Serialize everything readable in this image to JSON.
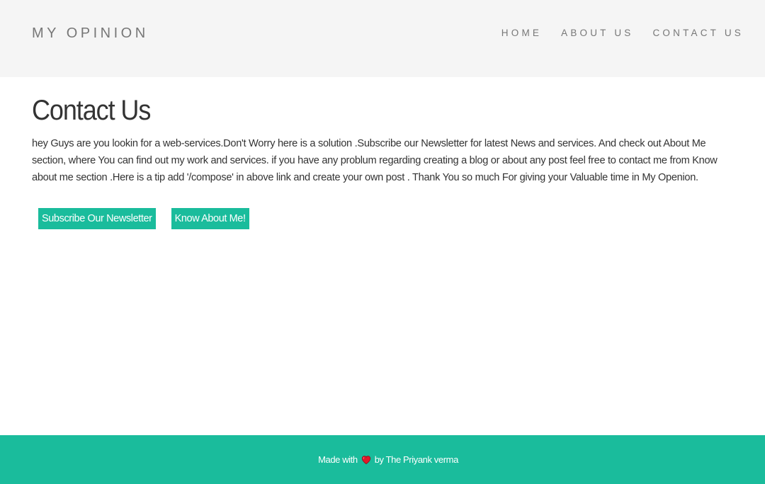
{
  "header": {
    "brand": "MY OPINION",
    "nav": [
      {
        "label": "HOME"
      },
      {
        "label": "ABOUT US"
      },
      {
        "label": "CONTACT US"
      }
    ]
  },
  "main": {
    "title": "Contact Us",
    "body": "hey Guys are you lookin for a web-services.Don't Worry here is a solution .Subscribe our Newsletter for latest News and services. And check out About Me section, where You can find out my work and services. if you have any problum regarding creating a blog or about any post feel free to contact me from Know about me section .Here is a tip add '/compose' in above link and create your own post . Thank You so much For giving your Valuable time in My Openion.",
    "buttons": {
      "subscribe_label": "Subscribe Our Newsletter",
      "about_label": "Know About Me!"
    }
  },
  "footer": {
    "prefix": "Made with",
    "icon": "heart-icon",
    "suffix": "by The Priyank verma"
  },
  "colors": {
    "accent": "#1abc9c",
    "navbar_bg": "#f5f5f5",
    "heart": "#e0192a"
  }
}
